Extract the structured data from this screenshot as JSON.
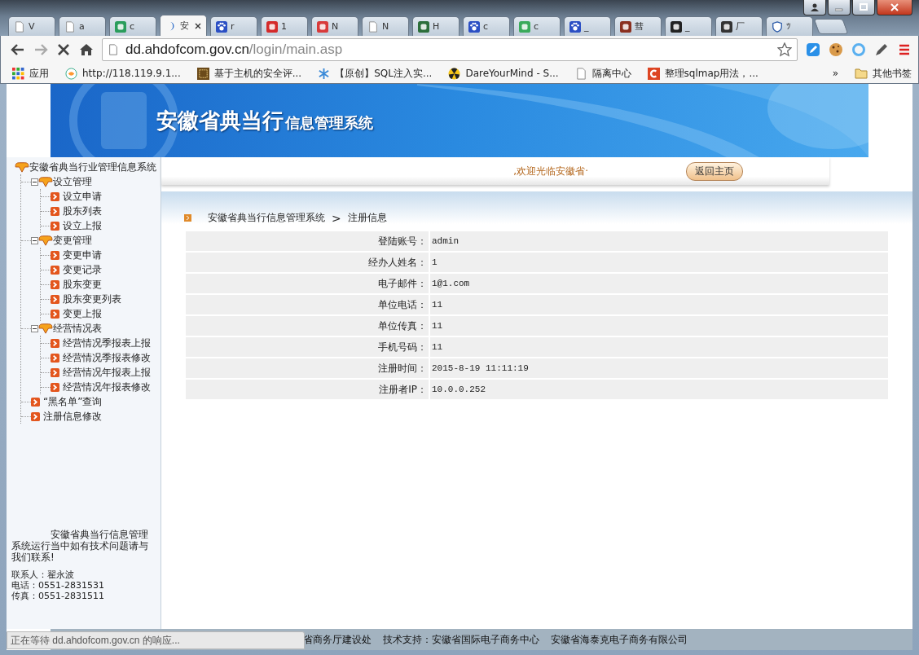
{
  "browser": {
    "tabs": [
      {
        "title": "V",
        "kind": "page",
        "selected": false
      },
      {
        "title": "a",
        "kind": "page",
        "selected": false
      },
      {
        "title": "c",
        "kind": "badge",
        "color": "#2a9d5c",
        "selected": false
      },
      {
        "title": "安",
        "kind": "moon",
        "selected": true
      },
      {
        "title": "r",
        "kind": "paw",
        "selected": false
      },
      {
        "title": "1",
        "kind": "badge",
        "color": "#d42a2a",
        "selected": false
      },
      {
        "title": "N",
        "kind": "badge",
        "color": "#d83a3a",
        "selected": false
      },
      {
        "title": "N",
        "kind": "page",
        "selected": false
      },
      {
        "title": "H",
        "kind": "badge",
        "color": "#2c6e3a",
        "selected": false
      },
      {
        "title": "c",
        "kind": "paw",
        "selected": false
      },
      {
        "title": "c",
        "kind": "badge",
        "color": "#3aaa5a",
        "selected": false
      },
      {
        "title": "_",
        "kind": "paw",
        "selected": false
      },
      {
        "title": "彗",
        "kind": "badge",
        "color": "#8a3020",
        "selected": false
      },
      {
        "title": "_",
        "kind": "badge",
        "color": "#222222",
        "selected": false
      },
      {
        "title": "厂",
        "kind": "badge",
        "color": "#333333",
        "selected": false
      },
      {
        "title": "ﾂ",
        "kind": "shield",
        "selected": false
      }
    ],
    "address": {
      "host": "dd.ahdofcom.gov.cn",
      "path": "/login/main.asp"
    },
    "bookmarks": [
      {
        "label": "应用",
        "kind": "grid"
      },
      {
        "label": "http://118.119.9.1...",
        "kind": "globe"
      },
      {
        "label": "基于主机的安全评...",
        "kind": "badge"
      },
      {
        "label": "【原创】SQL注入实...",
        "kind": "flake"
      },
      {
        "label": "DareYourMind - S...",
        "kind": "radiation"
      },
      {
        "label": "隔离中心",
        "kind": "page"
      },
      {
        "label": "整理sqlmap用法，...",
        "kind": "cbadge"
      }
    ],
    "more": "»",
    "other_bookmarks": "其他书签",
    "status": "正在等待 dd.ahdofcom.gov.cn 的响应..."
  },
  "banner": {
    "title": "安徽省典当行",
    "subtitle": "信息管理系统"
  },
  "sidebar": {
    "tree": {
      "label": "安徽省典当行业管理信息系统",
      "children": [
        {
          "label": "设立管理",
          "expanded": true,
          "children": [
            {
              "label": "设立申请"
            },
            {
              "label": "股东列表"
            },
            {
              "label": "设立上报"
            }
          ]
        },
        {
          "label": "变更管理",
          "expanded": true,
          "children": [
            {
              "label": "变更申请"
            },
            {
              "label": "变更记录"
            },
            {
              "label": "股东变更"
            },
            {
              "label": "股东变更列表"
            },
            {
              "label": "变更上报"
            }
          ]
        },
        {
          "label": "经营情况表",
          "expanded": true,
          "children": [
            {
              "label": "经营情况季报表上报"
            },
            {
              "label": "经营情况季报表修改"
            },
            {
              "label": "经营情况年报表上报"
            },
            {
              "label": "经营情况年报表修改"
            }
          ]
        },
        {
          "label": "“黑名单”查询"
        },
        {
          "label": "注册信息修改"
        }
      ]
    },
    "notice": "安徽省典当行信息管理系统运行当中如有技术问题请与我们联系!",
    "contact": [
      "联系人：翟永波",
      "电话：0551-2831531",
      "传真：0551-2831511"
    ]
  },
  "welcome": ",欢迎光临安徽省·",
  "home_button": "返回主页",
  "breadcrumb": {
    "items": [
      "安徽省典当行信息管理系统",
      "注册信息"
    ],
    "separator": ">"
  },
  "fields": [
    {
      "label": "登陆账号：",
      "value": "admin"
    },
    {
      "label": "经办人姓名：",
      "value": "1"
    },
    {
      "label": "电子邮件：",
      "value": "1@1.com"
    },
    {
      "label": "单位电话：",
      "value": "11"
    },
    {
      "label": "单位传真：",
      "value": "11"
    },
    {
      "label": "手机号码：",
      "value": "11"
    },
    {
      "label": "注册时间：",
      "value": "2015-8-19 11:11:19"
    },
    {
      "label": "注册者IP：",
      "value": "10.0.0.252"
    }
  ],
  "footer": [
    "省商务厅建设处",
    "技术支持：安徽省国际电子商务中心",
    "安徽省海泰克电子商务有限公司"
  ]
}
